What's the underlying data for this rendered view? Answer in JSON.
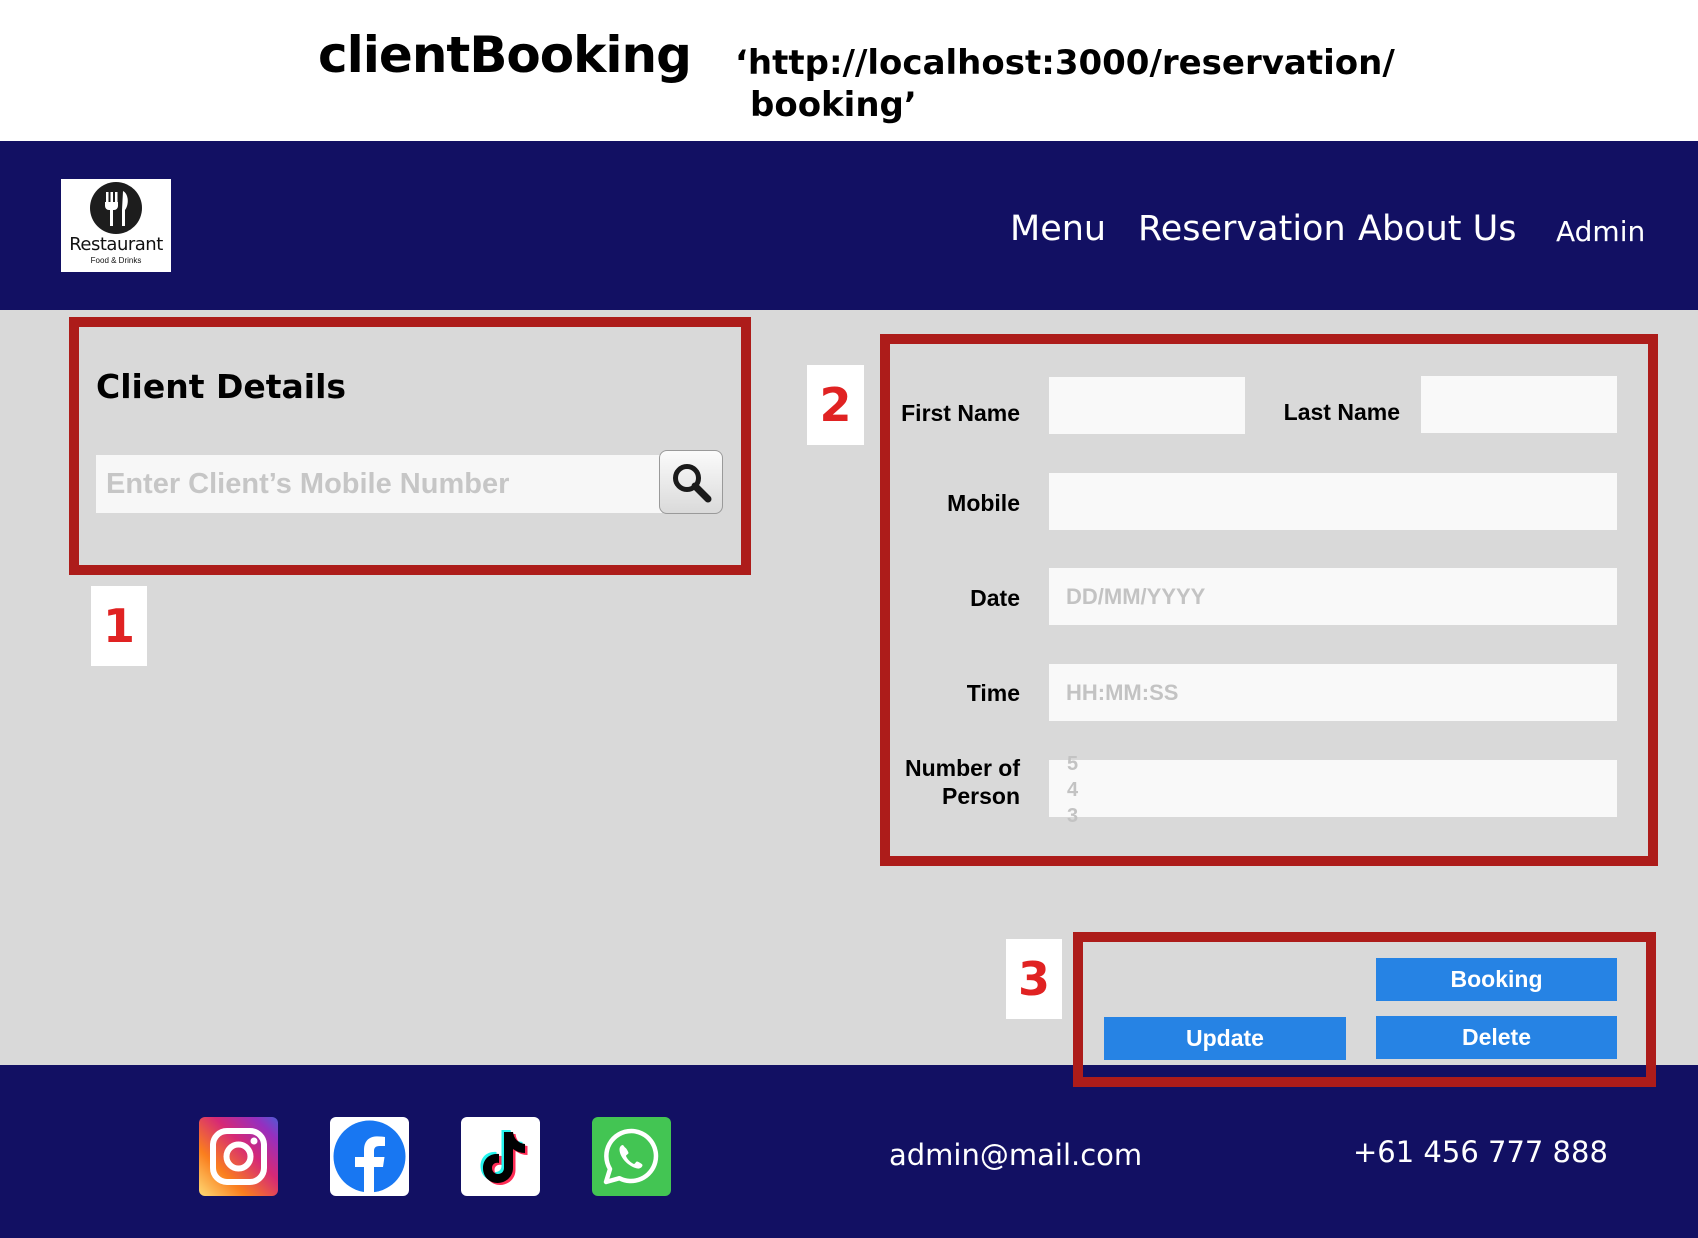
{
  "doc": {
    "title": "clientBooking",
    "url_line1": "‘http://localhost:3000/reservation/",
    "url_line2": "booking’"
  },
  "brand": {
    "name": "Restaurant",
    "tagline": "Food & Drinks",
    "logo_icon": "fork-knife-icon"
  },
  "nav": {
    "menu": "Menu",
    "reservation": "Reservation",
    "about": "About Us",
    "admin": "Admin"
  },
  "annotations": [
    "1",
    "2",
    "3"
  ],
  "client": {
    "title": "Client Details",
    "search_placeholder": "Enter Client’s Mobile Number",
    "search_icon": "search-icon"
  },
  "form": {
    "first_name_label": "First Name",
    "last_name_label": "Last Name",
    "mobile_label": "Mobile",
    "date_label": "Date",
    "date_placeholder": "DD/MM/YYYY",
    "time_label": "Time",
    "time_placeholder": "HH:MM:SS",
    "people_label_line1": "Number of",
    "people_label_line2": "Person",
    "people_options": [
      "5",
      "4",
      "3"
    ]
  },
  "actions": {
    "booking": "Booking",
    "update": "Update",
    "delete": "Delete"
  },
  "footer": {
    "socials": [
      "instagram-icon",
      "facebook-icon",
      "tiktok-icon",
      "whatsapp-icon"
    ],
    "email": "admin@mail.com",
    "phone": "+61 456 777 888"
  },
  "colors": {
    "nav_bg": "#121063",
    "page_bg": "#d9d9d9",
    "annotation_border": "#ad1c1a",
    "annotation_number": "#e02222",
    "button_bg": "#2683e4"
  }
}
